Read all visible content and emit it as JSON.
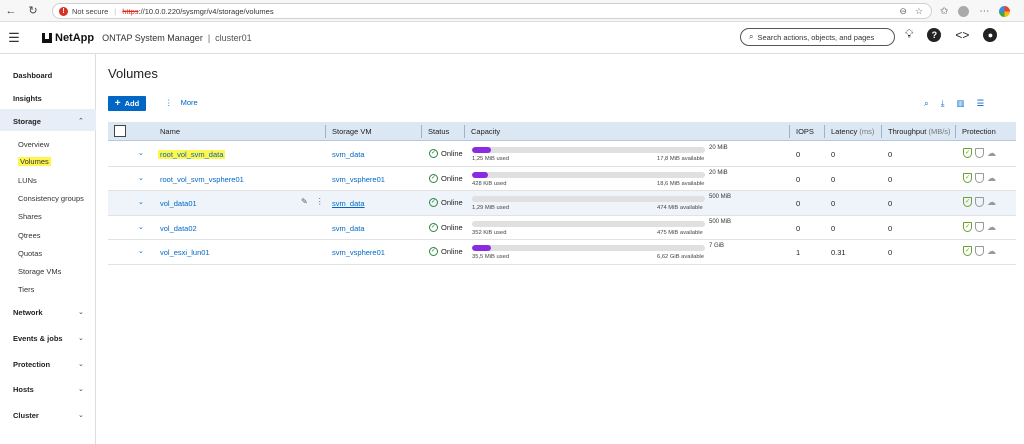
{
  "browser": {
    "not_secure": "Not secure",
    "url_scheme": "https",
    "url_rest": "://10.0.0.220/sysmgr/v4/storage/volumes"
  },
  "header": {
    "brand": "NetApp",
    "app_name": "ONTAP System Manager",
    "separator": "|",
    "cluster": "cluster01",
    "search_placeholder": "Search actions, objects, and pages"
  },
  "sidebar": {
    "items": [
      {
        "label": "Dashboard"
      },
      {
        "label": "Insights"
      },
      {
        "label": "Storage"
      },
      {
        "label": "Network"
      },
      {
        "label": "Events & jobs"
      },
      {
        "label": "Protection"
      },
      {
        "label": "Hosts"
      },
      {
        "label": "Cluster"
      }
    ],
    "storage_sub": [
      {
        "label": "Overview"
      },
      {
        "label": "Volumes"
      },
      {
        "label": "LUNs"
      },
      {
        "label": "Consistency groups"
      },
      {
        "label": "Shares"
      },
      {
        "label": "Qtrees"
      },
      {
        "label": "Quotas"
      },
      {
        "label": "Storage VMs"
      },
      {
        "label": "Tiers"
      }
    ]
  },
  "page": {
    "title": "Volumes",
    "add_label": "Add",
    "more_label": "More"
  },
  "table": {
    "headers": {
      "name": "Name",
      "svm": "Storage VM",
      "status": "Status",
      "capacity": "Capacity",
      "iops": "IOPS",
      "latency": "Latency",
      "latency_unit": "(ms)",
      "throughput": "Throughput",
      "throughput_unit": "(MB/s)",
      "protection": "Protection"
    },
    "rows": [
      {
        "name": "root_vol_svm_data",
        "svm": "svm_data",
        "status": "Online",
        "total": "20 MiB",
        "used": "1,25 MiB used",
        "avail": "17,8 MiB available",
        "fill": 0.08,
        "iops": "0",
        "latency": "0",
        "throughput": "0"
      },
      {
        "name": "root_vol_svm_vsphere01",
        "svm": "svm_vsphere01",
        "status": "Online",
        "total": "20 MiB",
        "used": "428 KiB used",
        "avail": "18,6 MiB available",
        "fill": 0.07,
        "iops": "0",
        "latency": "0",
        "throughput": "0"
      },
      {
        "name": "vol_data01",
        "svm": "svm_data",
        "status": "Online",
        "total": "500 MiB",
        "used": "1,29 MiB used",
        "avail": "474 MiB available",
        "fill": 0.0,
        "iops": "0",
        "latency": "0",
        "throughput": "0"
      },
      {
        "name": "vol_data02",
        "svm": "svm_data",
        "status": "Online",
        "total": "500 MiB",
        "used": "352 KiB used",
        "avail": "475 MiB available",
        "fill": 0.0,
        "iops": "0",
        "latency": "0",
        "throughput": "0"
      },
      {
        "name": "vol_esxi_lun01",
        "svm": "svm_vsphere01",
        "status": "Online",
        "total": "7 GiB",
        "used": "35,5 MiB used",
        "avail": "6,62 GiB available",
        "fill": 0.08,
        "iops": "1",
        "latency": "0.31",
        "throughput": "0"
      }
    ]
  },
  "colors": {
    "accent": "#0067c5",
    "capacity_fill": "#8a2be2",
    "online": "#2e8540",
    "highlight": "#fff64d"
  }
}
